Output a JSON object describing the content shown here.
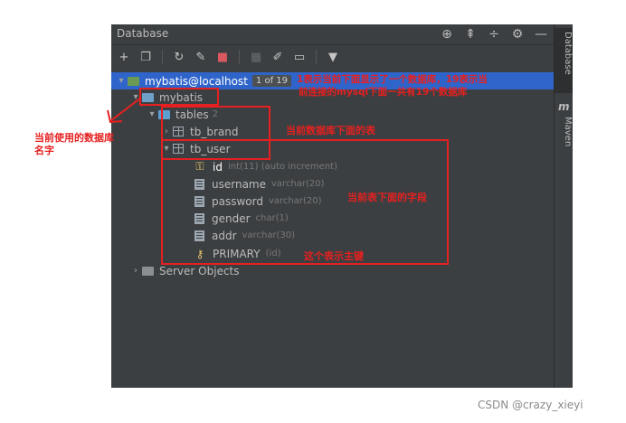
{
  "window": {
    "title": "Database"
  },
  "toolbar": {
    "buttons": [
      "add",
      "copy",
      "refresh",
      "edit-schema",
      "stop",
      "table",
      "edit",
      "console",
      "filter"
    ]
  },
  "tree": {
    "connection": {
      "label": "mybatis@localhost",
      "badge": "1 of 19"
    },
    "schema": {
      "label": "mybatis"
    },
    "tables_folder": {
      "label": "tables",
      "count": "2"
    },
    "tables": [
      {
        "label": "tb_brand"
      },
      {
        "label": "tb_user"
      }
    ],
    "columns": [
      {
        "name": "id",
        "type": "int(11) (auto increment)"
      },
      {
        "name": "username",
        "type": "varchar(20)"
      },
      {
        "name": "password",
        "type": "varchar(20)"
      },
      {
        "name": "gender",
        "type": "char(1)"
      },
      {
        "name": "addr",
        "type": "varchar(30)"
      }
    ],
    "key": {
      "name": "PRIMARY",
      "type": "(id)"
    },
    "server_objects": {
      "label": "Server Objects"
    }
  },
  "side_tabs": {
    "database": "Database",
    "maven": "Maven",
    "maven_icon": "m"
  },
  "annotations": {
    "schema_note_line1": "当前使用的数据库",
    "schema_note_line2": "名字",
    "badge_note_line1": "1表示当前下面显示了一个数据库，19表示当",
    "badge_note_line2": "前连接的mysql下面一共有19个数据库",
    "tables_note": "当前数据库下面的表",
    "fields_note": "当前表下面的字段",
    "pk_note": "这个表示主键"
  },
  "watermark": "CSDN @crazy_xieyi"
}
